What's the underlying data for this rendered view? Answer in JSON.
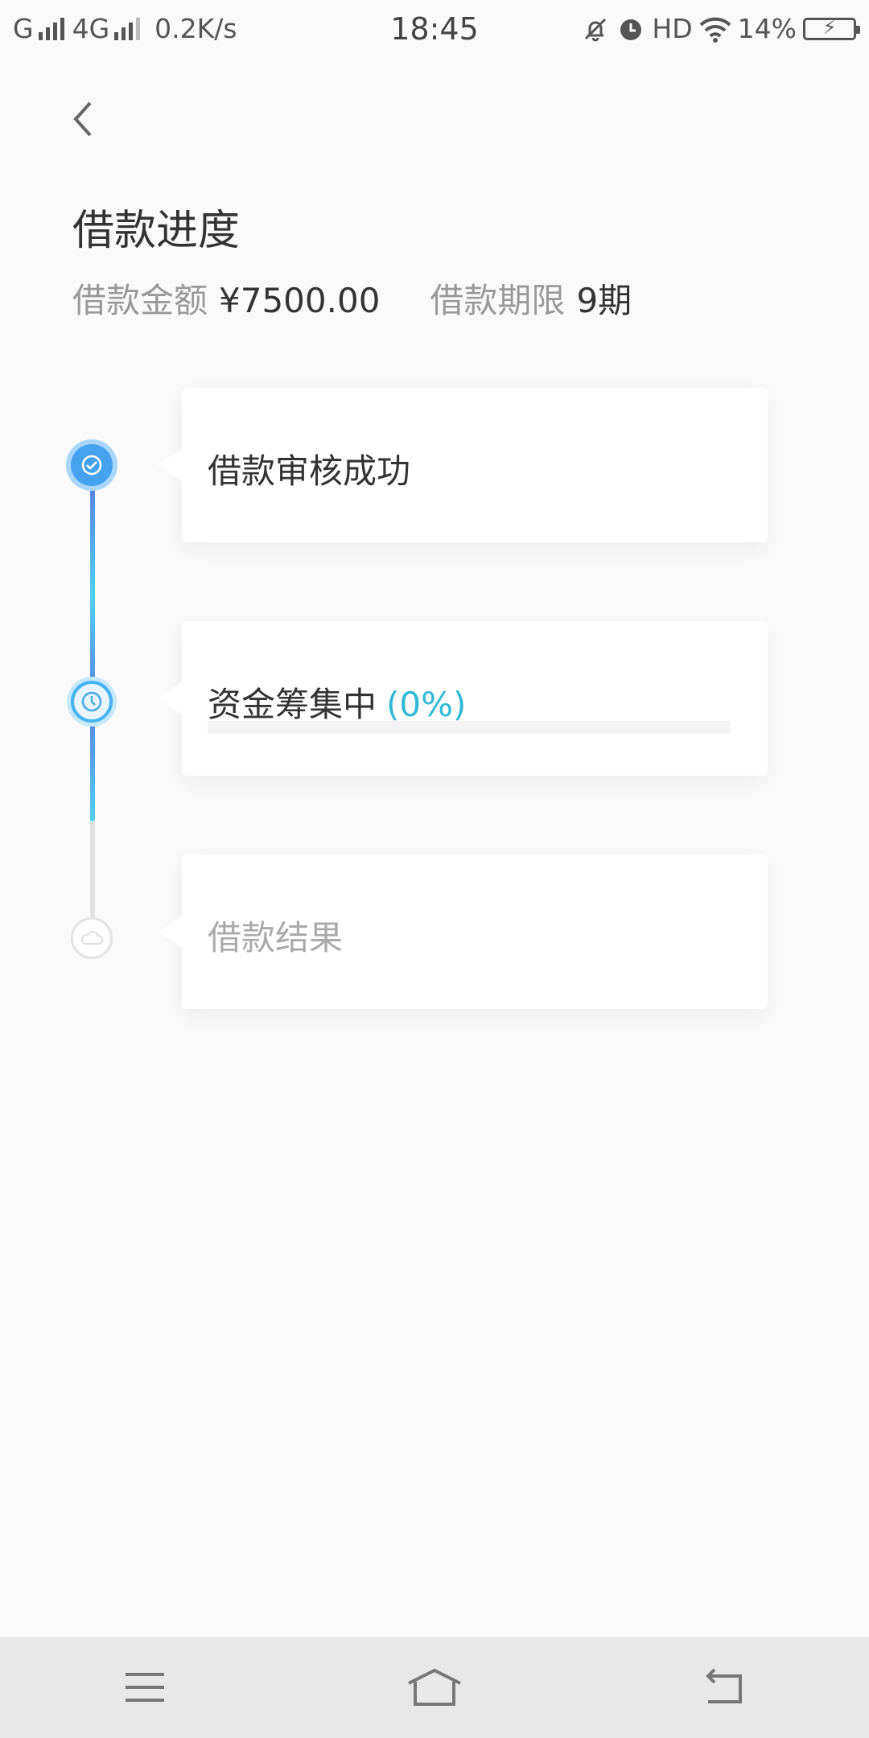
{
  "status_bar": {
    "carrier1": "G",
    "carrier2": "4G",
    "net_speed": "0.2K/s",
    "time": "18:45",
    "hd": "HD",
    "battery": "14%",
    "icons": [
      "mute-icon",
      "alarm-icon",
      "wifi-icon",
      "battery-charging-icon"
    ]
  },
  "header": {
    "title": "借款进度",
    "amount_label": "借款金额",
    "amount_value": "¥7500.00",
    "term_label": "借款期限",
    "term_value": "9期"
  },
  "steps": [
    {
      "label": "借款审核成功",
      "status": "done",
      "icon": "check-icon"
    },
    {
      "label": "资金筹集中",
      "percent_text": "(0%)",
      "progress": 0,
      "status": "current",
      "icon": "clock-icon"
    },
    {
      "label": "借款结果",
      "status": "pending",
      "icon": "cloud-icon"
    }
  ],
  "colors": {
    "accent": "#2fb9d6",
    "done_node": "#46a1ef",
    "line_gradient_top": "#5b7fe0",
    "line_gradient_bottom": "#4fd0ee",
    "pending_line": "#e2e2e2"
  },
  "navbar": {
    "icons": [
      "menu-icon",
      "home-icon",
      "back-icon"
    ]
  }
}
